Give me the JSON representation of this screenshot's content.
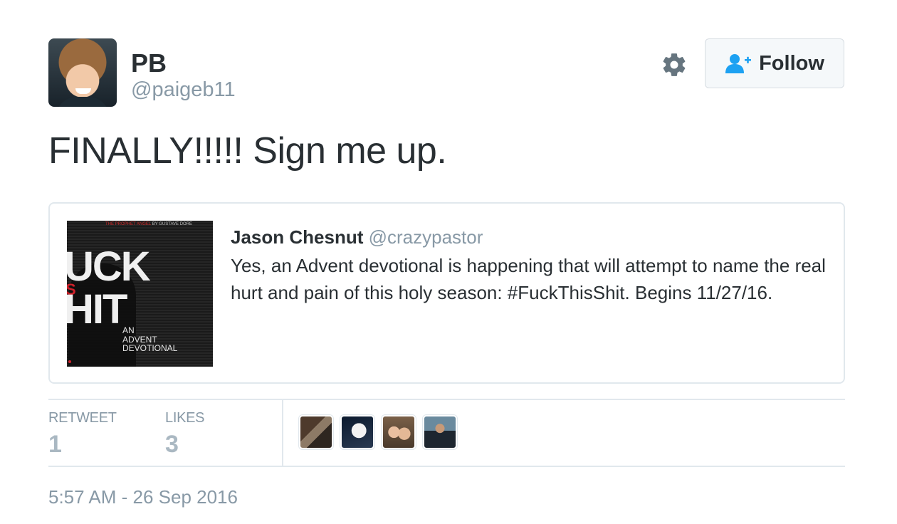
{
  "author": {
    "name": "PB",
    "handle": "@paigeb11"
  },
  "actions": {
    "follow_label": "Follow"
  },
  "tweet": {
    "text": "FINALLY!!!!! Sign me up.",
    "timestamp": "5:57 AM - 26 Sep 2016"
  },
  "quoted_tweet": {
    "author_name": "Jason Chesnut",
    "author_handle": "@crazypastor",
    "text": "Yes, an Advent devotional is happening that will attempt to name the real hurt and pain of this holy season: #FuckThisShit. Begins 11/27/16.",
    "image": {
      "top_red": "THE PROPHET ANGEL",
      "top_gray": "BY GUSTAVE DORE",
      "word1": "UCK",
      "word2": "S",
      "word3": "HIT",
      "subtitle_line1": "AN",
      "subtitle_line2": "ADVENT",
      "subtitle_line3": "DEVOTIONAL"
    }
  },
  "stats": {
    "retweets_label": "RETWEET",
    "retweets_count": "1",
    "likes_label": "LIKES",
    "likes_count": "3"
  },
  "icons": {
    "settings": "gear-icon",
    "follow": "person-add-icon"
  },
  "colors": {
    "accent": "#1da1f2",
    "text": "#292f33",
    "muted": "#8899a6",
    "border": "#e1e8ed"
  }
}
